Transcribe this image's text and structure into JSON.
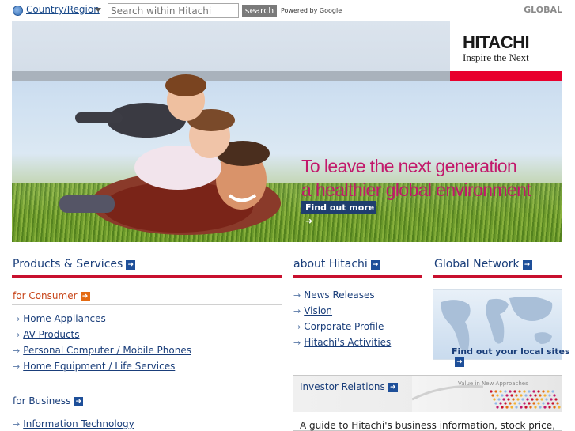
{
  "header": {
    "country_label": "Country/Region",
    "search_placeholder": "Search within Hitachi",
    "search_button": "search",
    "powered_by": "Powered by Google",
    "global_link": "GLOBAL"
  },
  "hero": {
    "logo_title": "HITACHI",
    "logo_tagline": "Inspire the Next",
    "headline_line1": "To leave the next generation",
    "headline_line2": "a healthier global environment",
    "cta": "Find out more ➜"
  },
  "products": {
    "title": "Products & Services",
    "consumer_title": "for Consumer",
    "consumer_items": [
      "Home Appliances",
      "AV Products",
      "Personal Computer / Mobile Phones",
      "Home Equipment / Life Services"
    ],
    "business_title": "for Business",
    "business_items": [
      "Information Technology"
    ]
  },
  "about": {
    "title": "about Hitachi",
    "items": [
      "News Releases",
      "Vision",
      "Corporate Profile",
      "Hitachi's Activities"
    ]
  },
  "global_network": {
    "title": "Global Network",
    "cta": "Find out your local sites"
  },
  "investor": {
    "title": "Investor Relations",
    "graphic_text": "Value in New Approaches",
    "description": "A guide to Hitachi's business information, stock price,"
  },
  "colors": {
    "brand_red": "#e8002d",
    "link_blue": "#1a3e7a",
    "accent_orange": "#e46a12",
    "headline_magenta": "#c2186b"
  }
}
